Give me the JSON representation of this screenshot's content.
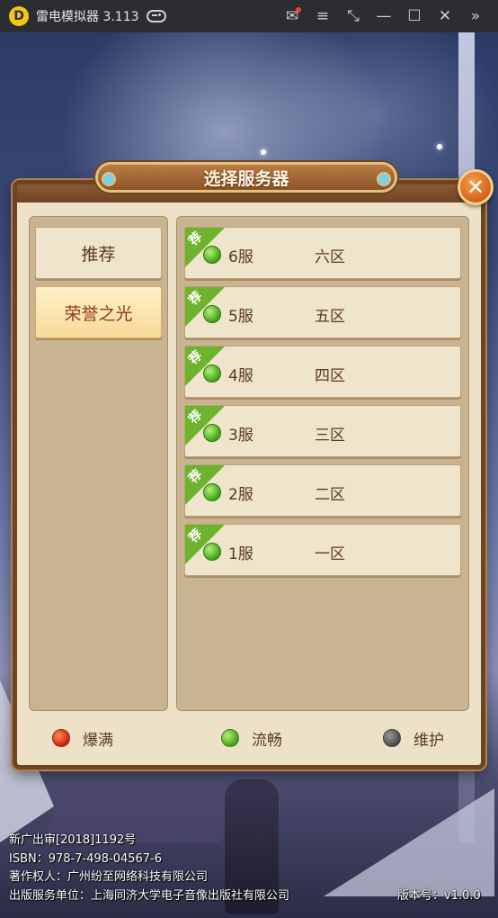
{
  "titlebar": {
    "app_name": "雷电模拟器 3.113",
    "logo_glyph": "D",
    "icons": [
      "mail-icon",
      "menu-icon",
      "resize-icon",
      "minimize-icon",
      "maximize-icon",
      "close-icon",
      "expand-icon"
    ],
    "icon_glyphs": {
      "mail": "✉",
      "menu": "≡",
      "resize": "⤡",
      "minimize": "—",
      "maximize": "☐",
      "close": "✕",
      "expand": "»"
    }
  },
  "dialog": {
    "title": "选择服务器",
    "close_glyph": "✕",
    "categories": [
      {
        "label": "推荐",
        "active": false
      },
      {
        "label": "荣誉之光",
        "active": true
      }
    ],
    "servers": [
      {
        "badge": "荐",
        "name": "6服",
        "zone": "六区",
        "status": "green"
      },
      {
        "badge": "荐",
        "name": "5服",
        "zone": "五区",
        "status": "green"
      },
      {
        "badge": "荐",
        "name": "4服",
        "zone": "四区",
        "status": "green"
      },
      {
        "badge": "荐",
        "name": "3服",
        "zone": "三区",
        "status": "green"
      },
      {
        "badge": "荐",
        "name": "2服",
        "zone": "二区",
        "status": "green"
      },
      {
        "badge": "荐",
        "name": "1服",
        "zone": "一区",
        "status": "green"
      }
    ],
    "legend": [
      {
        "label": "爆满",
        "color": "red"
      },
      {
        "label": "流畅",
        "color": "green"
      },
      {
        "label": "维护",
        "color": "gray"
      }
    ]
  },
  "footer": {
    "line1": "新广出审[2018]1192号",
    "line2": "ISBN：978-7-498-04567-6",
    "line3": "著作权人：广州纷至网络科技有限公司",
    "line4": "出版服务单位：上海同济大学电子音像出版社有限公司",
    "version": "版本号：v1.0.0"
  },
  "colors": {
    "accent": "#6e4424",
    "panel": "#c9b491",
    "status_green": "#3fa215",
    "status_red": "#d0200a",
    "status_gray": "#4a4a4a"
  }
}
